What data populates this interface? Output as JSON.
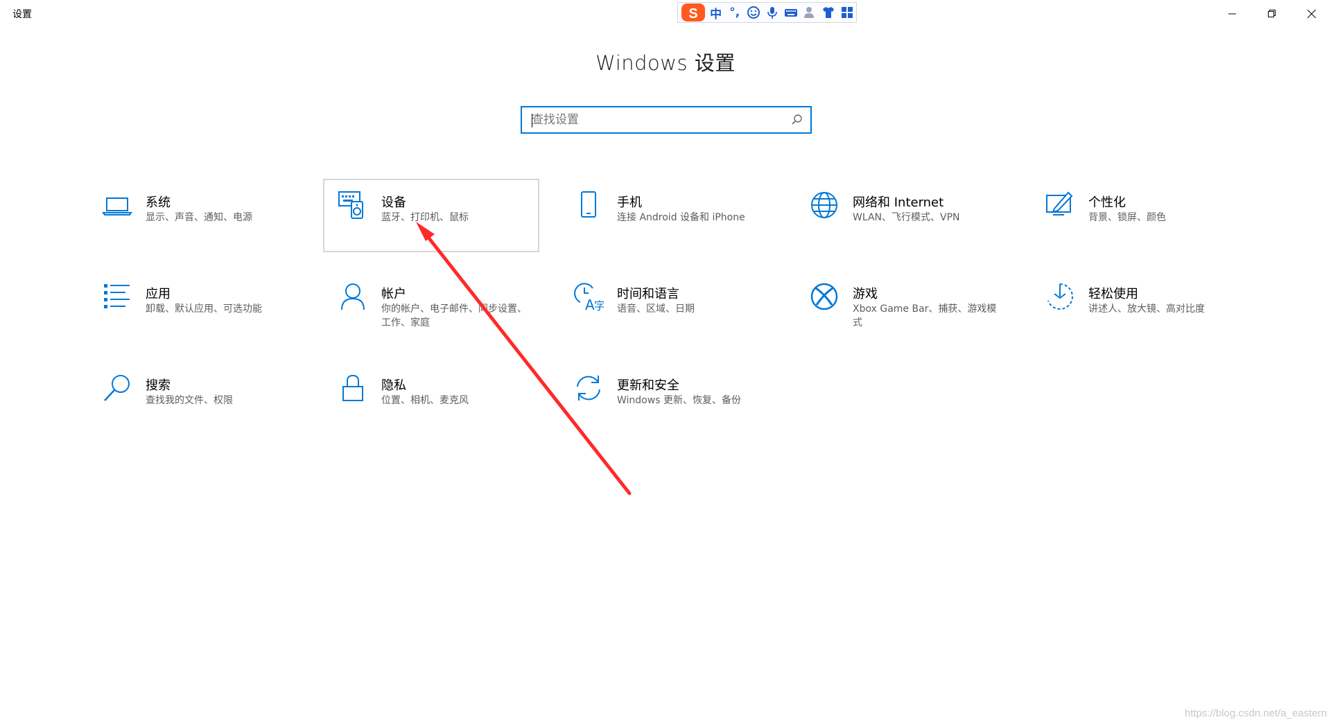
{
  "window": {
    "title": "设置",
    "controls": {
      "minimize": "minimize-icon",
      "restore": "restore-icon",
      "close": "close-icon"
    }
  },
  "ime_toolbar": {
    "logo": "sogou-logo",
    "mode_label": "中",
    "punct_label": "°,",
    "items": [
      "emoji-icon",
      "microphone-icon",
      "keyboard-icon",
      "user-icon",
      "skin-icon",
      "toolbox-icon"
    ]
  },
  "page": {
    "title": "Windows 设置",
    "search": {
      "placeholder": "查找设置",
      "value": ""
    }
  },
  "tiles": [
    {
      "name": "系统",
      "desc": "显示、声音、通知、电源",
      "icon": "laptop-icon"
    },
    {
      "name": "设备",
      "desc": "蓝牙、打印机、鼠标",
      "icon": "keyboard-speaker-icon",
      "hovered": true
    },
    {
      "name": "手机",
      "desc": "连接 Android 设备和 iPhone",
      "icon": "phone-icon"
    },
    {
      "name": "网络和 Internet",
      "desc": "WLAN、飞行模式、VPN",
      "icon": "globe-icon"
    },
    {
      "name": "个性化",
      "desc": "背景、锁屏、颜色",
      "icon": "paint-icon"
    },
    {
      "name": "应用",
      "desc": "卸载、默认应用、可选功能",
      "icon": "apps-list-icon"
    },
    {
      "name": "帐户",
      "desc": "你的帐户、电子邮件、同步设置、工作、家庭",
      "icon": "person-icon"
    },
    {
      "name": "时间和语言",
      "desc": "语音、区域、日期",
      "icon": "time-language-icon"
    },
    {
      "name": "游戏",
      "desc": "Xbox Game Bar、捕获、游戏模式",
      "icon": "xbox-icon"
    },
    {
      "name": "轻松使用",
      "desc": "讲述人、放大镜、高对比度",
      "icon": "ease-of-access-icon"
    },
    {
      "name": "搜索",
      "desc": "查找我的文件、权限",
      "icon": "search-icon"
    },
    {
      "name": "隐私",
      "desc": "位置、相机、麦克风",
      "icon": "lock-icon"
    },
    {
      "name": "更新和安全",
      "desc": "Windows 更新、恢复、备份",
      "icon": "update-icon"
    }
  ],
  "watermark": "https://blog.csdn.net/a_eastern",
  "colors": {
    "accent": "#0078d7",
    "annotation": "#ff2a2a"
  }
}
